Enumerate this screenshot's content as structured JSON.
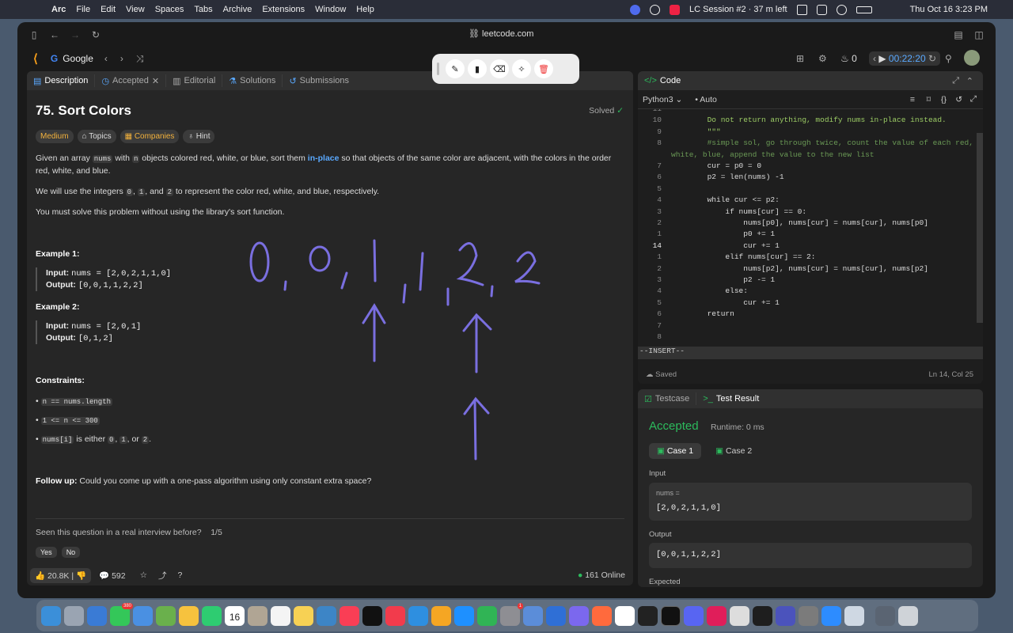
{
  "menubar": {
    "app": "Arc",
    "items": [
      "File",
      "Edit",
      "View",
      "Spaces",
      "Tabs",
      "Archive",
      "Extensions",
      "Window",
      "Help"
    ],
    "session": "LC Session #2 · 37 m left",
    "datetime": "Thu Oct 16  3:23 PM"
  },
  "browser": {
    "url": "leetcode.com",
    "search_engine": "Google",
    "streak": "0",
    "timer": "00:22:20"
  },
  "left_tabs": [
    "Description",
    "Accepted",
    "Editorial",
    "Solutions",
    "Submissions"
  ],
  "problem": {
    "title": "75. Sort Colors",
    "status": "Solved",
    "tags": [
      "Medium",
      "Topics",
      "Companies",
      "Hint"
    ],
    "p1_a": "Given an array",
    "p1_nums": "nums",
    "p1_b": "with",
    "p1_n": "n",
    "p1_c": "objects colored red, white, or blue, sort them",
    "p1_inplace": "in-place",
    "p1_d": "so that objects of the same color are adjacent, with the colors in the order red, white, and blue.",
    "p2_a": "We will use the integers",
    "p2_0": "0",
    "p2_sep": ",",
    "p2_1": "1",
    "p2_and": ", and",
    "p2_2": "2",
    "p2_b": "to represent the color red, white, and blue, respectively.",
    "p3": "You must solve this problem without using the library's sort function.",
    "ex1_title": "Example 1:",
    "ex1_input_label": "Input:",
    "ex1_input": "nums = [2,0,2,1,1,0]",
    "ex1_output_label": "Output:",
    "ex1_output": "[0,0,1,1,2,2]",
    "ex2_title": "Example 2:",
    "ex2_input_label": "Input:",
    "ex2_input": "nums = [2,0,1]",
    "ex2_output_label": "Output:",
    "ex2_output": "[0,1,2]",
    "constraints_title": "Constraints:",
    "c1": "n == nums.length",
    "c2": "1 <= n <= 300",
    "c3_code": "nums[i]",
    "c3_a": "is either",
    "c3_0": "0",
    "c3_1": "1",
    "c3_or": ", or",
    "c3_2": "2",
    "followup_label": "Follow up:",
    "followup": "Could you come up with a one-pass algorithm using only constant extra space?",
    "interview_q": "Seen this question in a real interview before?",
    "interview_count": "1/5",
    "yes": "Yes",
    "no": "No",
    "likes": "20.8K",
    "comments": "592",
    "online": "161 Online"
  },
  "annotation": {
    "digits": [
      "0",
      ",",
      "0",
      ",",
      "1",
      ",",
      "1",
      ",",
      "2",
      ",",
      "2"
    ]
  },
  "editor": {
    "title": "Code",
    "language": "Python3",
    "mode": "Auto",
    "mode_line": "--INSERT--",
    "saved": "Saved",
    "cursor": "Ln 14, Col 25",
    "line_numbers": [
      "11",
      "10",
      "9",
      "8",
      "",
      "7",
      "6",
      "5",
      "4",
      "3",
      "2",
      "1",
      "14",
      "1",
      "2",
      "3",
      "4",
      "5",
      "6",
      "7",
      "8"
    ],
    "lines": [
      "",
      "        Do not return anything, modify nums in-place instead.",
      "        \"\"\"",
      "        #simple sol, go through twice, count the value of each red,",
      "white, blue, append the value to the new list",
      "        cur = p0 = 0",
      "        p2 = len(nums) -1",
      "",
      "        while cur <= p2:",
      "            if nums[cur] == 0:",
      "                nums[p0], nums[cur] = nums[cur], nums[p0]",
      "                p0 += 1",
      "                cur += 1",
      "            elif nums[cur] == 2:",
      "                nums[p2], nums[cur] = nums[cur], nums[p2]",
      "                p2 -= 1",
      "            else:",
      "                cur += 1",
      "        return",
      "",
      ""
    ]
  },
  "result": {
    "tab_testcase": "Testcase",
    "tab_result": "Test Result",
    "status": "Accepted",
    "runtime": "Runtime: 0 ms",
    "case1": "Case 1",
    "case2": "Case 2",
    "input_label": "Input",
    "var_label": "nums =",
    "input_value": "[2,0,2,1,1,0]",
    "output_label": "Output",
    "output_value": "[0,0,1,1,2,2]",
    "expected_label": "Expected"
  },
  "dock": {
    "calendar_date": "16",
    "badge_messages": "380",
    "badge_settings": "1"
  }
}
